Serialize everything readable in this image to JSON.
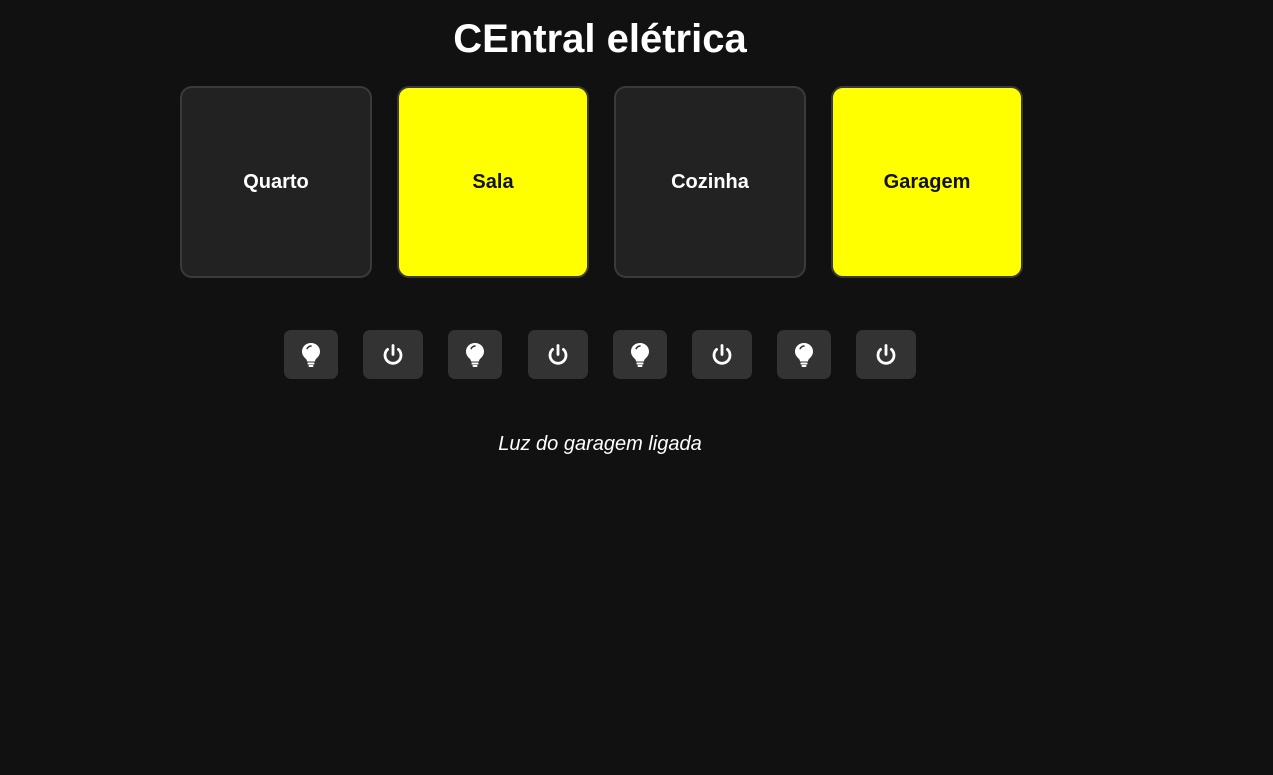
{
  "title": "CEntral elétrica",
  "rooms": [
    {
      "label": "Quarto",
      "state": "off"
    },
    {
      "label": "Sala",
      "state": "on"
    },
    {
      "label": "Cozinha",
      "state": "off"
    },
    {
      "label": "Garagem",
      "state": "on"
    }
  ],
  "controls": [
    {
      "room": "Quarto",
      "icons": [
        "lightbulb-icon",
        "power-icon"
      ]
    },
    {
      "room": "Sala",
      "icons": [
        "lightbulb-icon",
        "power-icon"
      ]
    },
    {
      "room": "Cozinha",
      "icons": [
        "lightbulb-icon",
        "power-icon"
      ]
    },
    {
      "room": "Garagem",
      "icons": [
        "lightbulb-icon",
        "power-icon"
      ]
    }
  ],
  "status_message": "Luz do garagem ligada",
  "colors": {
    "background": "#111111",
    "tile_off": "#222222",
    "tile_on": "#ffff00",
    "button": "#333333",
    "text": "#ffffff"
  }
}
